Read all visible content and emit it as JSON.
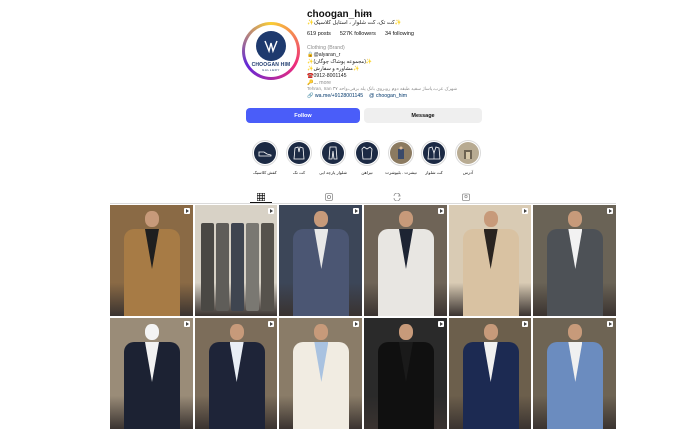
{
  "profile": {
    "username": "choogan_him",
    "more_icon": "···",
    "tagline": "✨کت تک، کت شلوار ، استایل کلاسیک✨",
    "logo_text": "CHOOGAN HIM",
    "logo_sub": "GALLERY",
    "posts": "619 posts",
    "followers": "527K followers",
    "following": "34 following",
    "category": "Clothing (Brand)",
    "bio_lines": [
      "🔒@alyaran_r",
      "✨(مجموعه پوشاک چوگان)✨",
      "✨مشاوره و سفارش✨",
      "☎️0912-8001145",
      "🔑..."
    ],
    "more_label": "more",
    "address": "Tehran, Iran  شهرک غرب،پاساژ سفید طبقه دوم روبروی بانک پله برقی،واحد ۳۷",
    "links": [
      "wa.me/+9128001145",
      "choogan_him"
    ]
  },
  "actions": {
    "follow": "Follow",
    "message": "Message"
  },
  "highlights": [
    {
      "label": "آدرس",
      "icon": "location-photo"
    },
    {
      "label": "کت شلوار",
      "icon": "suit-icon"
    },
    {
      "label": "تیشرت . بلیوشرت",
      "icon": "tshirt-photo"
    },
    {
      "label": "تیراهن",
      "icon": "shirt-icon"
    },
    {
      "label": "شلوار پارچه ایی",
      "icon": "pants-icon"
    },
    {
      "label": "کت تک",
      "icon": "jacket-icon"
    },
    {
      "label": "کفش کلاسیک",
      "icon": "shoe-icon"
    }
  ],
  "tabs": [
    {
      "name": "posts",
      "icon": "grid-icon",
      "active": true
    },
    {
      "name": "reels",
      "icon": "reels-icon",
      "active": false
    },
    {
      "name": "reposts",
      "icon": "repost-icon",
      "active": false
    },
    {
      "name": "tagged",
      "icon": "tagged-icon",
      "active": false
    }
  ],
  "posts": [
    {
      "bg": "#8a6a45",
      "jacket": "#a77b45",
      "shirt": "#1f1f1f"
    },
    {
      "bg": "#d8d2c6",
      "jacket": "#5e5c58",
      "shirt": "#7a7670"
    },
    {
      "bg": "#3c4658",
      "jacket": "#4b5673",
      "shirt": "#e8e8e8"
    },
    {
      "bg": "#6f6457",
      "jacket": "#e8e6e2",
      "shirt": "#1d2433"
    },
    {
      "bg": "#d9cbb4",
      "jacket": "#d9c2a2",
      "shirt": "#2a2420"
    },
    {
      "bg": "#6a6356",
      "jacket": "#4d5156",
      "shirt": "#f2f2f2"
    },
    {
      "bg": "#9a8c78",
      "jacket": "#1c2233",
      "shirt": "#f2f2f2"
    },
    {
      "bg": "#7c6d5a",
      "jacket": "#1e2438",
      "shirt": "#e9eef5"
    },
    {
      "bg": "#8a7c68",
      "jacket": "#f1ece2",
      "shirt": "#a9c2e0"
    },
    {
      "bg": "#2a2a2a",
      "jacket": "#101010",
      "shirt": "#1a1a1a"
    },
    {
      "bg": "#6c5f4c",
      "jacket": "#1c2a52",
      "shirt": "#f0f0f0"
    },
    {
      "bg": "#6e6454",
      "jacket": "#6b8cbf",
      "shirt": "#f0f0f0"
    }
  ]
}
